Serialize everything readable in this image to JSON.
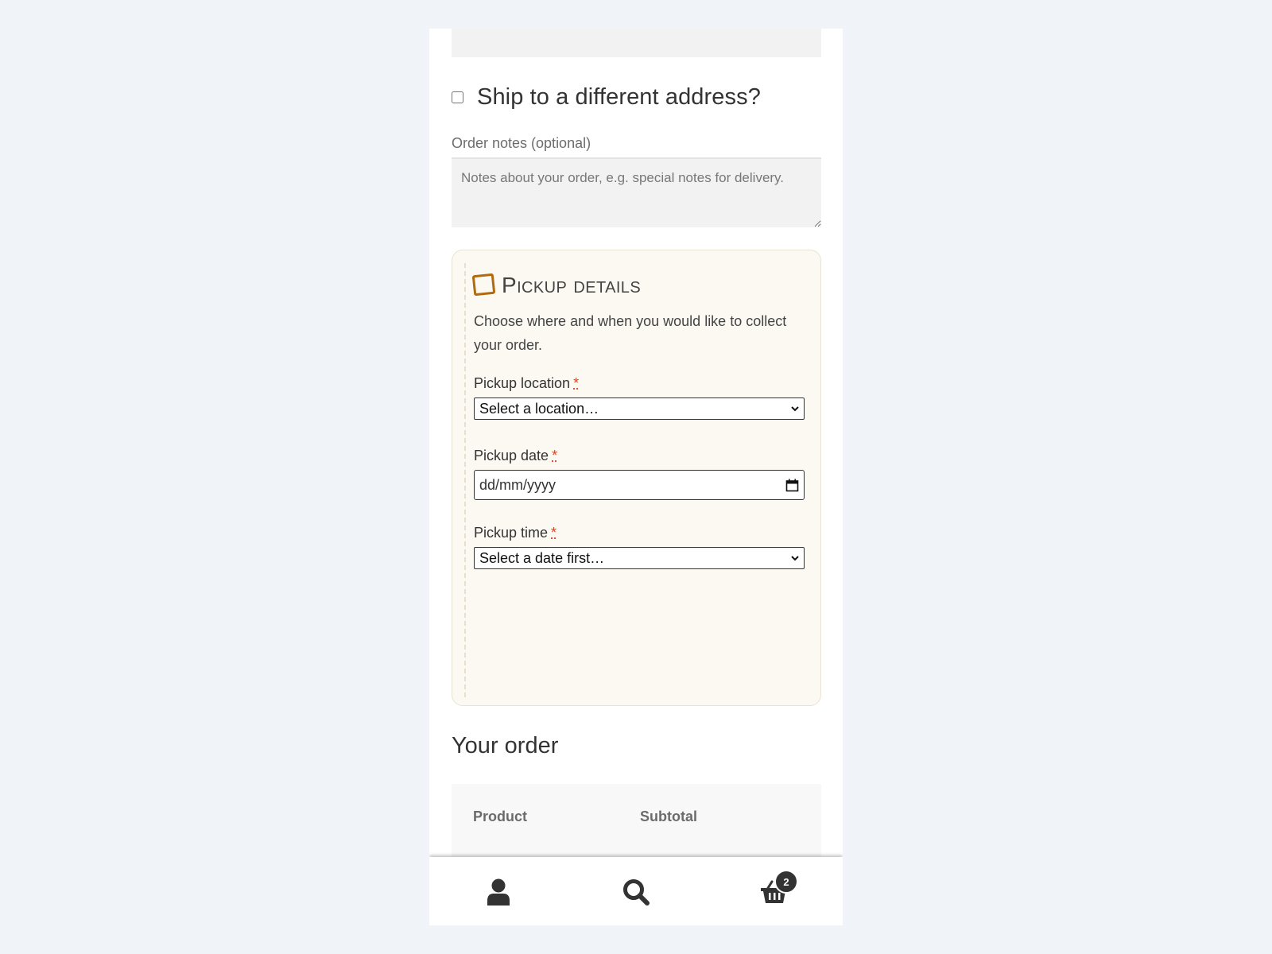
{
  "shipping": {
    "ship_different_label": "Ship to a different address?",
    "ship_different_checked": false
  },
  "order_notes": {
    "label": "Order notes (optional)",
    "placeholder": "Notes about your order, e.g. special notes for delivery."
  },
  "pickup": {
    "title": "Pickup details",
    "description": "Choose where and when you would like to collect your order.",
    "required_marker": "*",
    "accent_color": "#b06b10",
    "location": {
      "label": "Pickup location",
      "selected": "Select a location…"
    },
    "date": {
      "label": "Pickup date",
      "placeholder": "dd/mm/yyyy"
    },
    "time": {
      "label": "Pickup time",
      "selected": "Select a date first…"
    }
  },
  "order": {
    "title": "Your order",
    "columns": [
      "Product",
      "Subtotal"
    ]
  },
  "bottom_nav": {
    "items": [
      {
        "name": "account",
        "icon": "user-icon"
      },
      {
        "name": "search",
        "icon": "search-icon"
      },
      {
        "name": "cart",
        "icon": "basket-icon"
      }
    ],
    "cart_count": "2"
  }
}
